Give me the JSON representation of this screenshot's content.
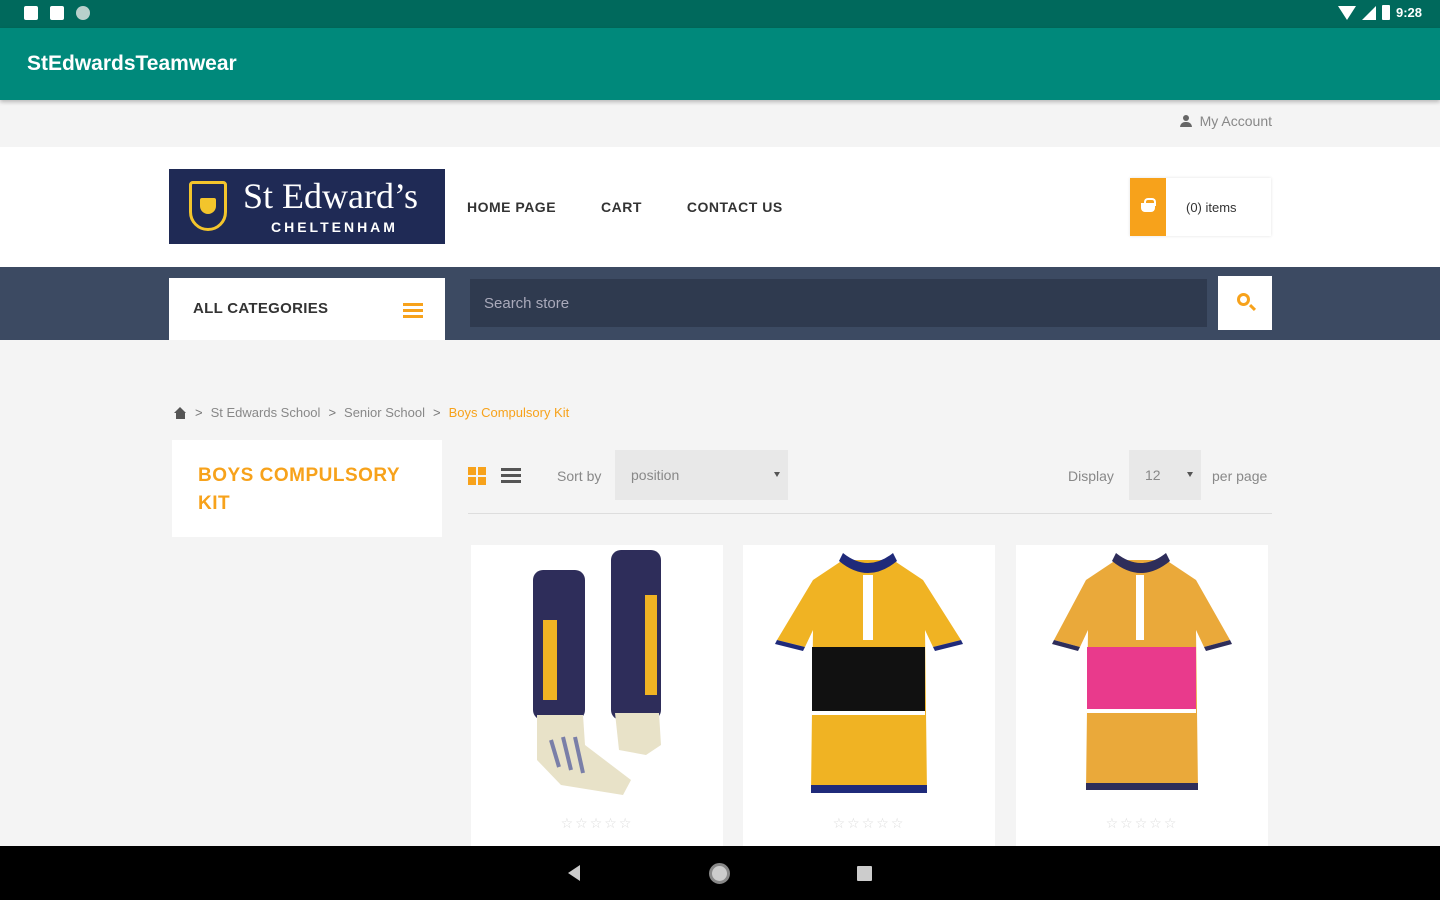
{
  "status_bar": {
    "time": "9:28"
  },
  "app_bar": {
    "title": "StEdwardsTeamwear"
  },
  "topbar": {
    "account_label": "My Account"
  },
  "header": {
    "logo_main": "St Edward’s",
    "logo_sub": "CHELTENHAM",
    "nav": [
      "HOME PAGE",
      "CART",
      "CONTACT US"
    ],
    "cart_label": "(0) items"
  },
  "searchbar": {
    "categories_label": "ALL CATEGORIES",
    "search_placeholder": "Search store"
  },
  "breadcrumb": {
    "sep": ">",
    "items": [
      "St Edwards School",
      "Senior School"
    ],
    "current": "Boys Compulsory Kit"
  },
  "sidebar": {
    "title": "BOYS COMPULSORY KIT"
  },
  "toolbar": {
    "sort_label": "Sort by",
    "sort_value": "position",
    "display_label": "Display",
    "display_value": "12",
    "perpage_label": "per page"
  },
  "products": [
    {
      "icon": "socks-image",
      "rating_glyphs": "☆☆☆☆☆"
    },
    {
      "icon": "black-hoop-shirt-image",
      "rating_glyphs": "☆☆☆☆☆"
    },
    {
      "icon": "pink-hoop-shirt-image",
      "rating_glyphs": "☆☆☆☆☆"
    }
  ],
  "colors": {
    "status_bar": "#00695c",
    "app_bar": "#00897b",
    "accent": "#f7a21b",
    "navy": "#1f2a55",
    "search_band": "#3c4a62"
  }
}
